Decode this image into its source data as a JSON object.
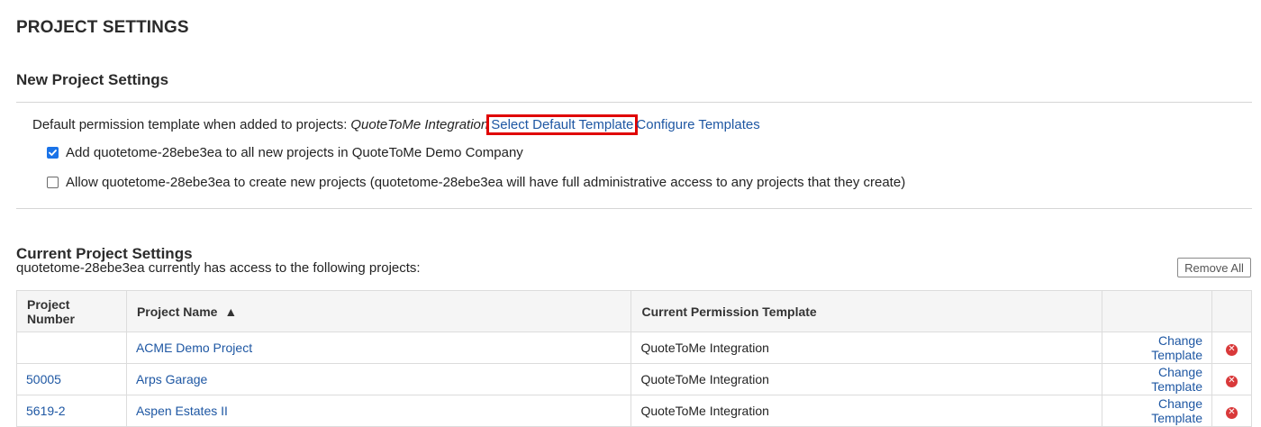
{
  "page": {
    "title": "PROJECT SETTINGS"
  },
  "new_project_settings": {
    "heading": "New Project Settings",
    "default_permission_label": "Default permission template when added to projects:",
    "default_template_name": "QuoteToMe Integration",
    "select_default_template_link": "Select Default Template",
    "configure_templates_link": "Configure Templates",
    "options": [
      {
        "label": "Add quotetome-28ebe3ea to all new projects in QuoteToMe Demo Company",
        "checked": true
      },
      {
        "label": "Allow quotetome-28ebe3ea to create new projects (quotetome-28ebe3ea will have full administrative access to any projects that they create)",
        "checked": false
      }
    ]
  },
  "current_project_settings": {
    "heading": "Current Project Settings",
    "subtitle": "quotetome-28ebe3ea currently has access to the following projects:",
    "remove_all_label": "Remove All",
    "table": {
      "headers": [
        "Project Number",
        "Project Name",
        "Current Permission Template",
        "",
        ""
      ],
      "sort_indicator": "▲",
      "rows": [
        {
          "project_number": "",
          "project_name": "ACME Demo Project",
          "template": "QuoteToMe Integration",
          "action": "Change Template"
        },
        {
          "project_number": "50005",
          "project_name": "Arps Garage",
          "template": "QuoteToMe Integration",
          "action": "Change Template"
        },
        {
          "project_number": "5619-2",
          "project_name": "Aspen Estates II",
          "template": "QuoteToMe Integration",
          "action": "Change Template"
        }
      ]
    }
  },
  "colors": {
    "link": "#1e57a3",
    "highlight_border": "#e00000",
    "checkbox_checked": "#1a73e8",
    "delete_icon": "#d9393a"
  },
  "icons": {
    "checkbox_checked": "checkmark-icon",
    "delete": "remove-circle-icon",
    "sort": "sort-ascending-icon"
  }
}
